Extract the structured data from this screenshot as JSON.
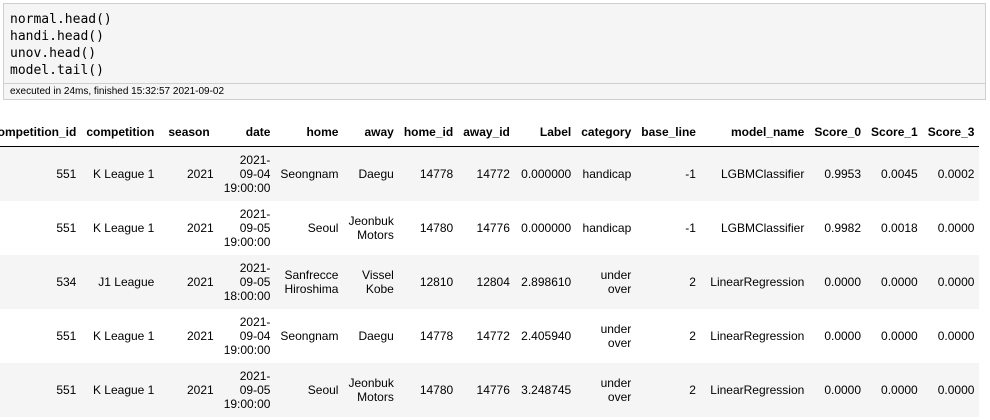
{
  "code_lines": [
    "normal.head()",
    "handi.head()",
    "unov.head()",
    "model.tail()"
  ],
  "exec_status": "executed in 24ms, finished 15:32:57 2021-09-02",
  "table": {
    "columns": [
      "competition_id",
      "competition",
      "season",
      "date",
      "home",
      "away",
      "home_id",
      "away_id",
      "Label",
      "category",
      "base_line",
      "model_name",
      "Score_0",
      "Score_1",
      "Score_3"
    ],
    "rows": [
      [
        "551",
        "K League 1",
        "2021",
        "2021-09-04 19:00:00",
        "Seongnam",
        "Daegu",
        "14778",
        "14772",
        "0.000000",
        "handicap",
        "-1",
        "LGBMClassifier",
        "0.9953",
        "0.0045",
        "0.0002"
      ],
      [
        "551",
        "K League 1",
        "2021",
        "2021-09-05 19:00:00",
        "Seoul",
        "Jeonbuk Motors",
        "14780",
        "14776",
        "0.000000",
        "handicap",
        "-1",
        "LGBMClassifier",
        "0.9982",
        "0.0018",
        "0.0000"
      ],
      [
        "534",
        "J1 League",
        "2021",
        "2021-09-05 18:00:00",
        "Sanfrecce Hiroshima",
        "Vissel Kobe",
        "12810",
        "12804",
        "2.898610",
        "under over",
        "2",
        "LinearRegression",
        "0.0000",
        "0.0000",
        "0.0000"
      ],
      [
        "551",
        "K League 1",
        "2021",
        "2021-09-04 19:00:00",
        "Seongnam",
        "Daegu",
        "14778",
        "14772",
        "2.405940",
        "under over",
        "2",
        "LinearRegression",
        "0.0000",
        "0.0000",
        "0.0000"
      ],
      [
        "551",
        "K League 1",
        "2021",
        "2021-09-05 19:00:00",
        "Seoul",
        "Jeonbuk Motors",
        "14780",
        "14776",
        "3.248745",
        "under over",
        "2",
        "LinearRegression",
        "0.0000",
        "0.0000",
        "0.0000"
      ]
    ]
  }
}
